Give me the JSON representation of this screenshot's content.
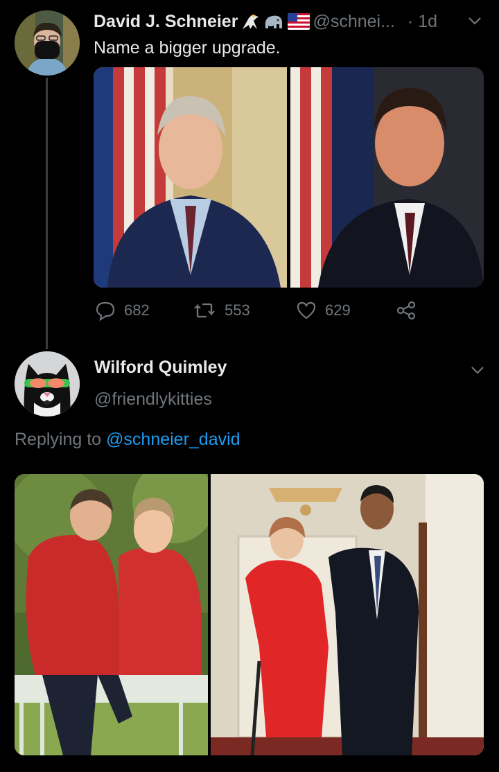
{
  "tweet1": {
    "author_name": "David J. Schneier",
    "handle": "@schnei...",
    "time": "· 1d",
    "text": "Name a bigger upgrade.",
    "badges": [
      "eagle-emoji",
      "elephant-emoji",
      "us-flag-emoji"
    ],
    "actions": {
      "replies": "682",
      "retweets": "553",
      "likes": "629"
    }
  },
  "tweet2": {
    "author_name": "Wilford Quimley",
    "handle": "@friendlykitties",
    "replying_prefix": "Replying to",
    "replying_to": "@schneier_david"
  },
  "colors": {
    "background": "#000000",
    "text": "#e7e9ea",
    "muted": "#71767b",
    "link": "#1d9bf0",
    "thread_line": "#3a3d40"
  }
}
